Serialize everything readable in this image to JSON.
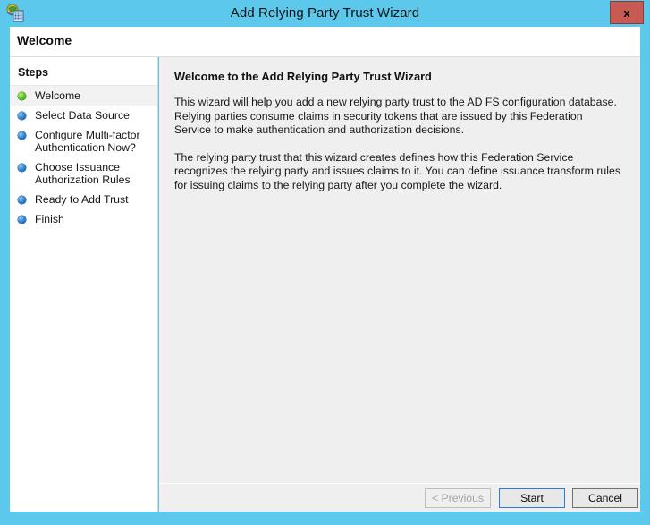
{
  "window": {
    "title": "Add Relying Party Trust Wizard",
    "icon": "adfs-server-globe-icon",
    "close_label": "x",
    "frame_color": "#5BC8EC",
    "close_button_color": "#C75B54"
  },
  "header": {
    "page_title": "Welcome"
  },
  "sidebar": {
    "heading": "Steps",
    "items": [
      {
        "label": "Welcome",
        "state": "current",
        "bullet": "green"
      },
      {
        "label": "Select Data Source",
        "state": "pending",
        "bullet": "blue"
      },
      {
        "label": "Configure Multi-factor\nAuthentication Now?",
        "state": "pending",
        "bullet": "blue"
      },
      {
        "label": "Choose Issuance\nAuthorization Rules",
        "state": "pending",
        "bullet": "blue"
      },
      {
        "label": "Ready to Add Trust",
        "state": "pending",
        "bullet": "blue"
      },
      {
        "label": "Finish",
        "state": "pending",
        "bullet": "blue"
      }
    ]
  },
  "main": {
    "heading": "Welcome to the Add Relying Party Trust Wizard",
    "paragraphs": [
      "This wizard will help you add a new relying party trust to the AD FS configuration database.  Relying parties consume claims in security tokens that are issued by this Federation Service to make authentication and authorization decisions.",
      "The relying party trust that this wizard creates defines how this Federation Service recognizes the relying party and issues claims to it. You can define issuance transform rules for issuing claims to the relying party after you complete the wizard."
    ]
  },
  "buttons": {
    "previous": "< Previous",
    "start": "Start",
    "cancel": "Cancel",
    "previous_enabled": false,
    "start_is_default": true
  }
}
